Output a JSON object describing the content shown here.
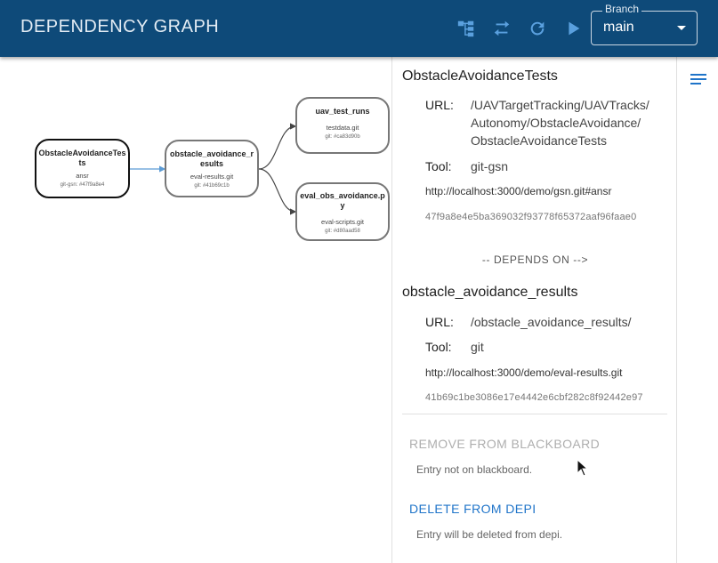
{
  "header": {
    "title": "DEPENDENCY GRAPH",
    "branch_label": "Branch",
    "branch_value": "main",
    "icons": [
      "hierarchy-icon",
      "swap-icon",
      "refresh-icon",
      "play-icon"
    ]
  },
  "graph": {
    "nodes": [
      {
        "name": "ObstacleAvoidanceTests",
        "sub": "ansr",
        "hash": "git-gsn: #47f9a8e4"
      },
      {
        "name": "obstacle_avoidance_results",
        "sub": "eval-results.git",
        "hash": "git: #41b69c1b"
      },
      {
        "name": "uav_test_runs",
        "sub": "testdata.git",
        "hash": "git: #ca83d90b"
      },
      {
        "name": "eval_obs_avoidance.py",
        "sub": "eval-scripts.git",
        "hash": "git: #d80aad58"
      }
    ]
  },
  "panel": {
    "primary": {
      "title": "ObstacleAvoidanceTests",
      "url_label": "URL:",
      "url_lines": [
        "/UAVTargetTracking/UAVTracks/",
        "Autonomy/ObstacleAvoidance/",
        "ObstacleAvoidanceTests"
      ],
      "tool_label": "Tool:",
      "tool": "git-gsn",
      "link": "http://localhost:3000/demo/gsn.git#ansr",
      "hash": "47f9a8e4e5ba369032f93778f65372aaf96faae0"
    },
    "depends_on": "-- DEPENDS ON -->",
    "secondary": {
      "title": "obstacle_avoidance_results",
      "url_label": "URL:",
      "url": "/obstacle_avoidance_results/",
      "tool_label": "Tool:",
      "tool": "git",
      "link": "http://localhost:3000/demo/eval-results.git",
      "hash": "41b69c1be3086e17e4442e6cbf282c8f92442e97"
    },
    "actions": {
      "remove_label": "REMOVE FROM BLACKBOARD",
      "remove_note": "Entry not on blackboard.",
      "delete_label": "DELETE FROM DEPI",
      "delete_note": "Entry will be deleted from depi."
    }
  },
  "colors": {
    "header_bg": "#0e4a79",
    "accent_link": "#1f74c9",
    "edge_selected": "#5b9bd5"
  }
}
